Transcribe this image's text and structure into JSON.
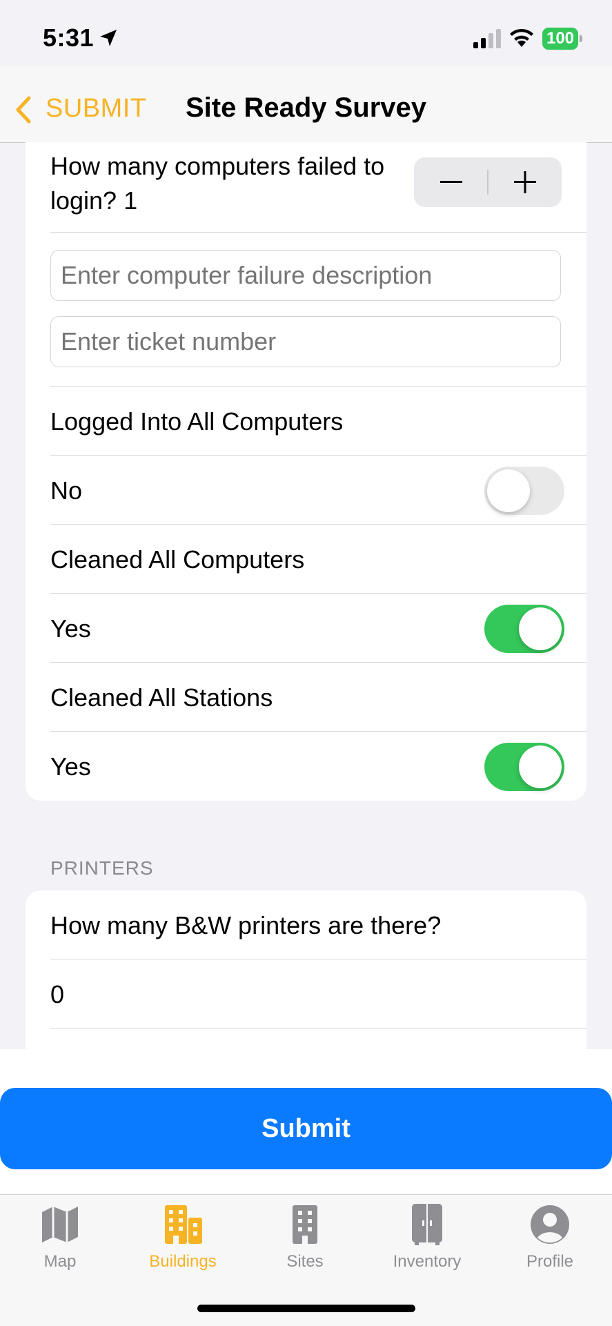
{
  "status_bar": {
    "time": "5:31",
    "battery": "100"
  },
  "nav": {
    "back_label": "SUBMIT",
    "title": "Site Ready Survey"
  },
  "computers": {
    "failed_login_label": "How many computers failed to login? 1",
    "stepper_minus": "−",
    "stepper_plus": "+",
    "failure_description_placeholder": "Enter computer failure description",
    "ticket_number_placeholder": "Enter ticket number",
    "logged_into_all_label": "Logged Into All Computers",
    "logged_into_all_value": "No",
    "cleaned_all_computers_label": "Cleaned All Computers",
    "cleaned_all_computers_value": "Yes",
    "cleaned_all_stations_label": "Cleaned All Stations",
    "cleaned_all_stations_value": "Yes"
  },
  "printers": {
    "section_header": "PRINTERS",
    "bw_question": "How many B&W printers are there?",
    "bw_value": "0"
  },
  "submit_label": "Submit",
  "tabs": [
    {
      "label": "Map",
      "icon": "map-icon"
    },
    {
      "label": "Buildings",
      "icon": "buildings-icon",
      "active": true
    },
    {
      "label": "Sites",
      "icon": "sites-icon"
    },
    {
      "label": "Inventory",
      "icon": "inventory-icon"
    },
    {
      "label": "Profile",
      "icon": "profile-icon"
    }
  ],
  "colors": {
    "accent": "#f6b324",
    "primary": "#0a7aff",
    "toggle_on": "#34c759"
  }
}
